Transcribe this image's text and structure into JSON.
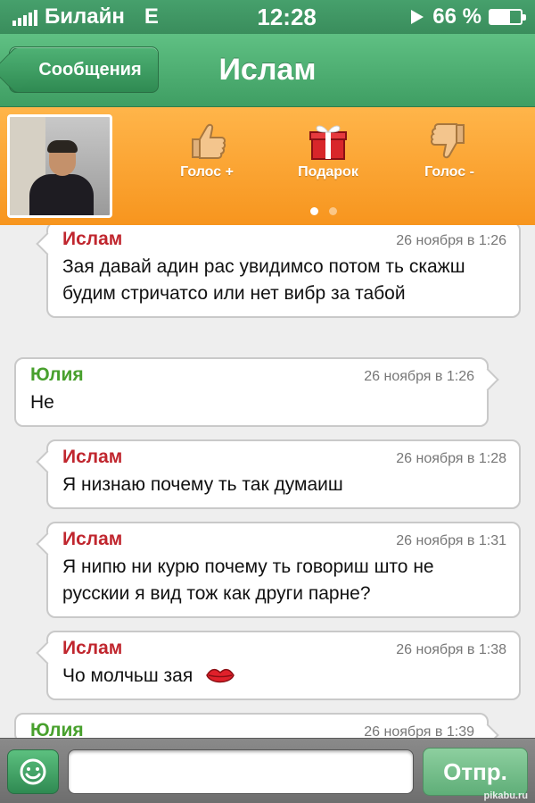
{
  "status_bar": {
    "carrier": "Билайн",
    "network": "E",
    "time": "12:28",
    "battery": "66 %",
    "battery_level": 0.66,
    "signal_bars": 5
  },
  "nav": {
    "back_label": "Сообщения",
    "title": "Ислам"
  },
  "profile": {
    "actions": [
      {
        "label": "Голос +",
        "icon": "thumbs-up-icon"
      },
      {
        "label": "Подарок",
        "icon": "gift-icon"
      },
      {
        "label": "Голос -",
        "icon": "thumbs-down-icon"
      }
    ],
    "page_dots": 2,
    "active_dot": 0
  },
  "messages": [
    {
      "author": "Ислам",
      "time": "26 ноября в 1:26",
      "text": "Зая давай адин рас увидимсо потом ть скажш будим стричатсо или нет вибр за табой",
      "direction": "in"
    },
    {
      "author": "Юлия",
      "time": "26 ноября в 1:26",
      "text": "Не",
      "direction": "out"
    },
    {
      "author": "Ислам",
      "time": "26 ноября в 1:28",
      "text": "Я низнаю почему ть так думаиш",
      "direction": "in"
    },
    {
      "author": "Ислам",
      "time": "26 ноября в 1:31",
      "text": "Я нипю ни курю почему ть говориш што не русскии я вид тож как други парне?",
      "direction": "in"
    },
    {
      "author": "Ислам",
      "time": "26 ноября в 1:38",
      "text": "Чо молчьш зая",
      "direction": "in",
      "emoji": "kiss-lips-icon"
    },
    {
      "author": "Юлия",
      "time": "26 ноября в 1:39",
      "text": "",
      "direction": "out"
    }
  ],
  "input": {
    "placeholder": "",
    "value": "",
    "send_label": "Отпр.",
    "emoji_icon": "smiley-icon"
  },
  "watermark": "pikabu.ru",
  "colors": {
    "green": "#3f9e63",
    "orange": "#f7951e",
    "islam_name": "#c0262e",
    "yulia_name": "#48a02d"
  }
}
